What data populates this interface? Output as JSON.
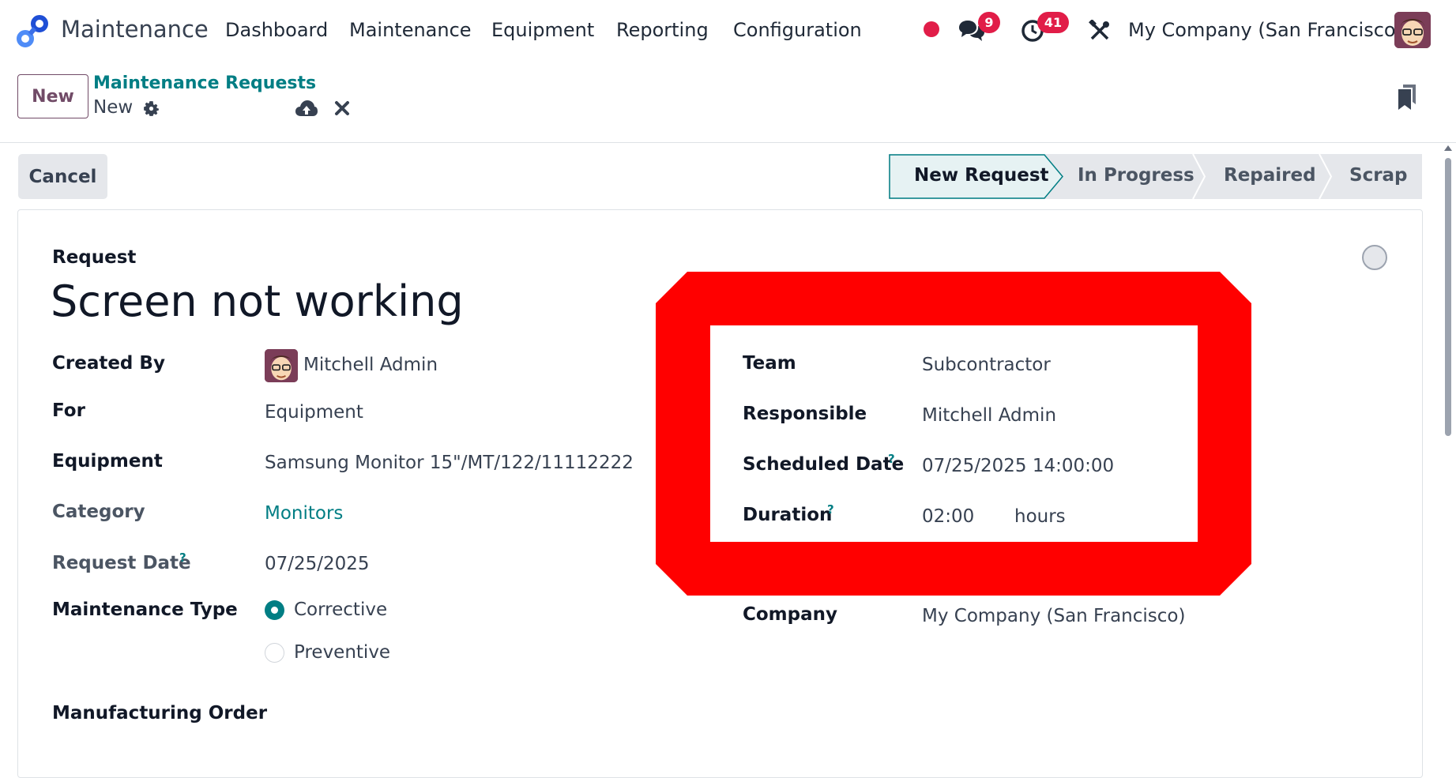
{
  "navbar": {
    "app_name": "Maintenance",
    "menus": [
      "Dashboard",
      "Maintenance",
      "Equipment",
      "Reporting",
      "Configuration"
    ],
    "messages_count": "9",
    "activities_count": "41",
    "company": "My Company (San Francisco)"
  },
  "control_panel": {
    "new_label": "New",
    "breadcrumb_parent": "Maintenance Requests",
    "breadcrumb_current": "New"
  },
  "status": {
    "cancel_label": "Cancel",
    "stages": [
      "New Request",
      "In Progress",
      "Repaired",
      "Scrap"
    ],
    "active_stage": "New Request"
  },
  "form": {
    "title_label": "Request",
    "title_value": "Screen not working",
    "created_by_label": "Created By",
    "created_by_value": "Mitchell Admin",
    "for_label": "For",
    "for_value": "Equipment",
    "equipment_label": "Equipment",
    "equipment_value": "Samsung Monitor 15\"/MT/122/11112222",
    "category_label": "Category",
    "category_value": "Monitors",
    "request_date_label": "Request Date",
    "request_date_value": "07/25/2025",
    "maintenance_type_label": "Maintenance Type",
    "maintenance_type_options": [
      "Corrective",
      "Preventive"
    ],
    "maintenance_type_selected": "Corrective",
    "manufacturing_order_label": "Manufacturing Order",
    "team_label": "Team",
    "team_value": "Subcontractor",
    "responsible_label": "Responsible",
    "responsible_value": "Mitchell Admin",
    "scheduled_date_label": "Scheduled Date",
    "scheduled_date_value": "07/25/2025 14:00:00",
    "duration_label": "Duration",
    "duration_value": "02:00",
    "duration_unit": "hours",
    "company_label": "Company",
    "company_value": "My Company (San Francisco)",
    "help_mark": "?"
  },
  "colors": {
    "brand": "#714b67",
    "accent": "#017e84",
    "badge": "#e11d48",
    "highlight": "#ff0000"
  }
}
